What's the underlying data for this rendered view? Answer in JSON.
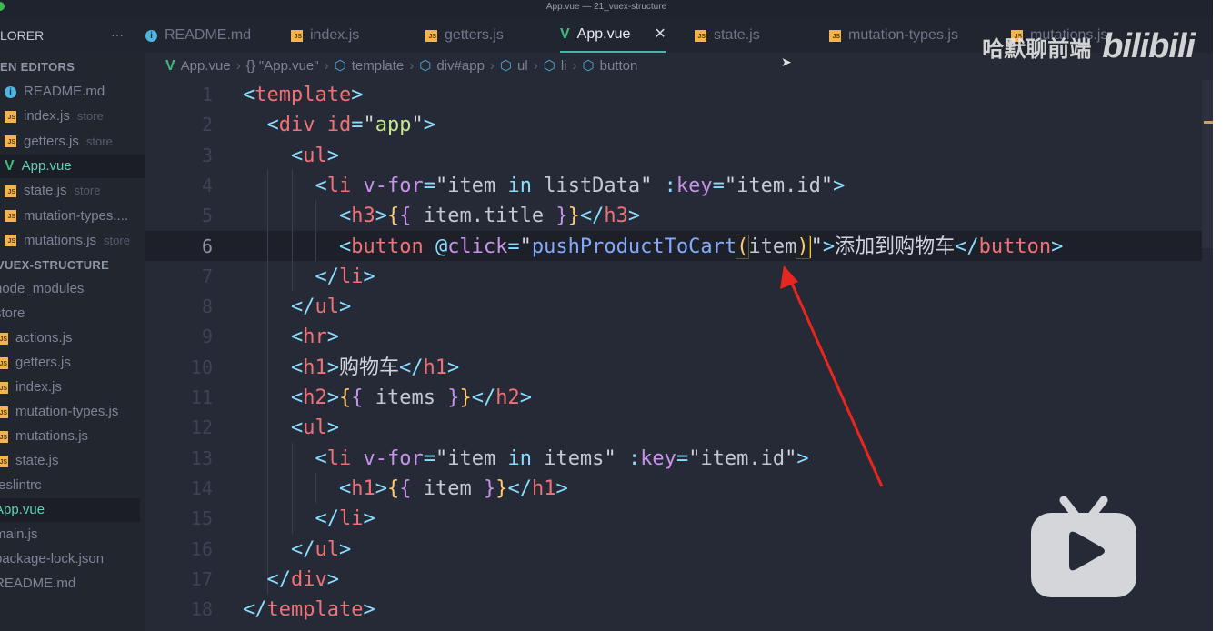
{
  "window": {
    "title": "App.vue — 21_vuex-structure"
  },
  "explorer": {
    "title": "LORER",
    "more": "···",
    "open_editors_label": "EN EDITORS",
    "open_editors": [
      {
        "name": "README.md",
        "icon": "info-icon",
        "hint": ""
      },
      {
        "name": "index.js",
        "icon": "js-icon",
        "hint": "store"
      },
      {
        "name": "getters.js",
        "icon": "js-icon",
        "hint": "store"
      },
      {
        "name": "App.vue",
        "icon": "vue-icon",
        "hint": "",
        "selected": true
      },
      {
        "name": "state.js",
        "icon": "js-icon",
        "hint": "store"
      },
      {
        "name": "mutation-types....",
        "icon": "js-icon",
        "hint": ""
      },
      {
        "name": "mutations.js",
        "icon": "js-icon",
        "hint": "store"
      }
    ],
    "project_label": "VUEX-STRUCTURE",
    "tree": [
      {
        "name": "node_modules",
        "icon": "",
        "indent": 0
      },
      {
        "name": "store",
        "icon": "",
        "indent": 0
      },
      {
        "name": "actions.js",
        "icon": "js-icon",
        "indent": 1
      },
      {
        "name": "getters.js",
        "icon": "js-icon",
        "indent": 1
      },
      {
        "name": "index.js",
        "icon": "js-icon",
        "indent": 1
      },
      {
        "name": "mutation-types.js",
        "icon": "js-icon",
        "indent": 1
      },
      {
        "name": "mutations.js",
        "icon": "js-icon",
        "indent": 1
      },
      {
        "name": "state.js",
        "icon": "js-icon",
        "indent": 1
      },
      {
        "name": ".eslintrc",
        "icon": "",
        "indent": 0
      },
      {
        "name": "App.vue",
        "icon": "",
        "indent": 0,
        "selected": true
      },
      {
        "name": "main.js",
        "icon": "",
        "indent": 0
      },
      {
        "name": "package-lock.json",
        "icon": "",
        "indent": 0
      },
      {
        "name": "README.md",
        "icon": "",
        "indent": 0
      }
    ]
  },
  "tabs": [
    {
      "label": "README.md",
      "icon": "info-icon"
    },
    {
      "label": "index.js",
      "icon": "js-icon"
    },
    {
      "label": "getters.js",
      "icon": "js-icon"
    },
    {
      "label": "App.vue",
      "icon": "vue-icon",
      "active": true,
      "close": "✕"
    },
    {
      "label": "state.js",
      "icon": "js-icon"
    },
    {
      "label": "mutation-types.js",
      "icon": "js-icon"
    },
    {
      "label": "mutations.js",
      "icon": "js-icon"
    }
  ],
  "breadcrumb": [
    "App.vue",
    "{} \"App.vue\"",
    "template",
    "div#app",
    "ul",
    "li",
    "button"
  ],
  "editor": {
    "current_line": 6,
    "lines": [
      [
        [
          "p",
          "<"
        ],
        [
          "t",
          "template"
        ],
        [
          "p",
          ">"
        ]
      ],
      [
        [
          "x",
          "  "
        ],
        [
          "p",
          "<"
        ],
        [
          "t",
          "div "
        ],
        [
          "t",
          "id"
        ],
        [
          "p",
          "="
        ],
        [
          "q",
          "\""
        ],
        [
          "g",
          "app"
        ],
        [
          "q",
          "\""
        ],
        [
          "p",
          ">"
        ]
      ],
      [
        [
          "x",
          "    "
        ],
        [
          "p",
          "<"
        ],
        [
          "t",
          "ul"
        ],
        [
          "p",
          ">"
        ]
      ],
      [
        [
          "x",
          "      "
        ],
        [
          "p",
          "<"
        ],
        [
          "t",
          "li "
        ],
        [
          "a",
          "v-for"
        ],
        [
          "p",
          "="
        ],
        [
          "q",
          "\""
        ],
        [
          "s",
          "item "
        ],
        [
          "k",
          "in"
        ],
        [
          "s",
          " listData"
        ],
        [
          "q",
          "\""
        ],
        [
          "x",
          " "
        ],
        [
          "p",
          ":"
        ],
        [
          "a",
          "key"
        ],
        [
          "p",
          "="
        ],
        [
          "q",
          "\""
        ],
        [
          "s",
          "item.id"
        ],
        [
          "q",
          "\""
        ],
        [
          "p",
          ">"
        ]
      ],
      [
        [
          "x",
          "        "
        ],
        [
          "p",
          "<"
        ],
        [
          "t",
          "h3"
        ],
        [
          "p",
          ">"
        ],
        [
          "y",
          "{"
        ],
        [
          "m",
          "{"
        ],
        [
          "s",
          " item.title "
        ],
        [
          "m",
          "}"
        ],
        [
          "y",
          "}"
        ],
        [
          "p",
          "</"
        ],
        [
          "t",
          "h3"
        ],
        [
          "p",
          ">"
        ]
      ],
      [
        [
          "x",
          "        "
        ],
        [
          "p",
          "<"
        ],
        [
          "t",
          "button "
        ],
        [
          "p",
          "@"
        ],
        [
          "a",
          "click"
        ],
        [
          "p",
          "="
        ],
        [
          "q",
          "\""
        ],
        [
          "f",
          "pushProductToCart"
        ],
        [
          "y",
          "("
        ],
        [
          "s",
          "item"
        ],
        [
          "y",
          ")"
        ],
        [
          "q",
          "\""
        ],
        [
          "p",
          ">"
        ],
        [
          "x",
          "添加到购物车"
        ],
        [
          "p",
          "</"
        ],
        [
          "t",
          "button"
        ],
        [
          "p",
          ">"
        ]
      ],
      [
        [
          "x",
          "      "
        ],
        [
          "p",
          "</"
        ],
        [
          "t",
          "li"
        ],
        [
          "p",
          ">"
        ]
      ],
      [
        [
          "x",
          "    "
        ],
        [
          "p",
          "</"
        ],
        [
          "t",
          "ul"
        ],
        [
          "p",
          ">"
        ]
      ],
      [
        [
          "x",
          "    "
        ],
        [
          "p",
          "<"
        ],
        [
          "t",
          "hr"
        ],
        [
          "p",
          ">"
        ]
      ],
      [
        [
          "x",
          "    "
        ],
        [
          "p",
          "<"
        ],
        [
          "t",
          "h1"
        ],
        [
          "p",
          ">"
        ],
        [
          "x",
          "购物车"
        ],
        [
          "p",
          "</"
        ],
        [
          "t",
          "h1"
        ],
        [
          "p",
          ">"
        ]
      ],
      [
        [
          "x",
          "    "
        ],
        [
          "p",
          "<"
        ],
        [
          "t",
          "h2"
        ],
        [
          "p",
          ">"
        ],
        [
          "y",
          "{"
        ],
        [
          "m",
          "{"
        ],
        [
          "s",
          " items "
        ],
        [
          "m",
          "}"
        ],
        [
          "y",
          "}"
        ],
        [
          "p",
          "</"
        ],
        [
          "t",
          "h2"
        ],
        [
          "p",
          ">"
        ]
      ],
      [
        [
          "x",
          "    "
        ],
        [
          "p",
          "<"
        ],
        [
          "t",
          "ul"
        ],
        [
          "p",
          ">"
        ]
      ],
      [
        [
          "x",
          "      "
        ],
        [
          "p",
          "<"
        ],
        [
          "t",
          "li "
        ],
        [
          "a",
          "v-for"
        ],
        [
          "p",
          "="
        ],
        [
          "q",
          "\""
        ],
        [
          "s",
          "item "
        ],
        [
          "k",
          "in"
        ],
        [
          "s",
          " items"
        ],
        [
          "q",
          "\""
        ],
        [
          "x",
          " "
        ],
        [
          "p",
          ":"
        ],
        [
          "a",
          "key"
        ],
        [
          "p",
          "="
        ],
        [
          "q",
          "\""
        ],
        [
          "s",
          "item.id"
        ],
        [
          "q",
          "\""
        ],
        [
          "p",
          ">"
        ]
      ],
      [
        [
          "x",
          "        "
        ],
        [
          "p",
          "<"
        ],
        [
          "t",
          "h1"
        ],
        [
          "p",
          ">"
        ],
        [
          "y",
          "{"
        ],
        [
          "m",
          "{"
        ],
        [
          "s",
          " item "
        ],
        [
          "m",
          "}"
        ],
        [
          "y",
          "}"
        ],
        [
          "p",
          "</"
        ],
        [
          "t",
          "h1"
        ],
        [
          "p",
          ">"
        ]
      ],
      [
        [
          "x",
          "      "
        ],
        [
          "p",
          "</"
        ],
        [
          "t",
          "li"
        ],
        [
          "p",
          ">"
        ]
      ],
      [
        [
          "x",
          "    "
        ],
        [
          "p",
          "</"
        ],
        [
          "t",
          "ul"
        ],
        [
          "p",
          ">"
        ]
      ],
      [
        [
          "x",
          "  "
        ],
        [
          "p",
          "</"
        ],
        [
          "t",
          "div"
        ],
        [
          "p",
          ">"
        ]
      ],
      [
        [
          "p",
          "</"
        ],
        [
          "t",
          "template"
        ],
        [
          "p",
          ">"
        ]
      ]
    ]
  },
  "watermark": {
    "channel": "哈默聊前端",
    "logo": "bilibili"
  },
  "colors": {
    "annotation_arrow": "#e8261f",
    "accent": "#4fb3a9"
  }
}
